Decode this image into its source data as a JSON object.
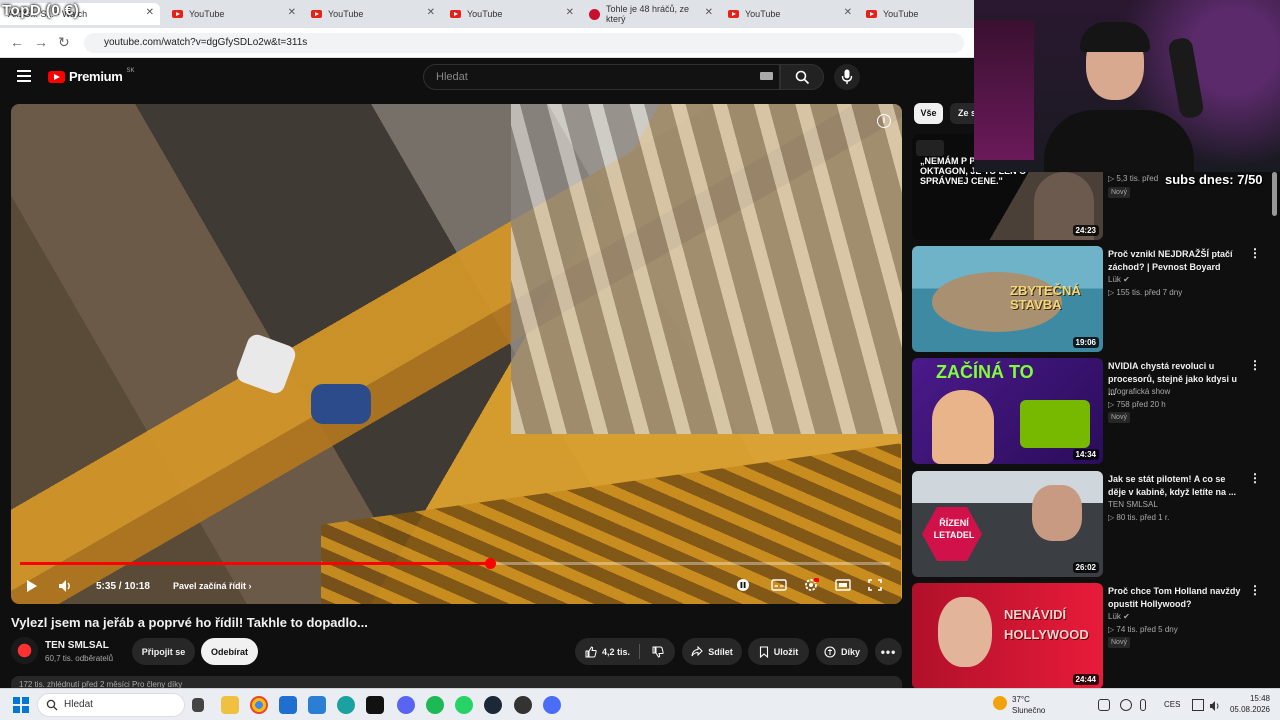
{
  "overlay_title": "TopD (0 €)",
  "browser": {
    "tabs": [
      {
        "title": "Ak1G... S... - Watch"
      },
      {
        "title": "YouTube"
      },
      {
        "title": "YouTube"
      },
      {
        "title": "YouTube"
      },
      {
        "title": "Tohle je 48 hráčů, ze který"
      },
      {
        "title": "YouTube"
      },
      {
        "title": "YouTube"
      }
    ],
    "url": "youtube.com/watch?v=dgGfySDLo2w&t=311s"
  },
  "header": {
    "logo_text": "Premium",
    "logo_country": "SK",
    "search_placeholder": "Hledat"
  },
  "player": {
    "time": "5:35 / 10:18",
    "chapter": "Pavel začíná řídit",
    "progress": 0.54,
    "info_icon": "i"
  },
  "video": {
    "title": "Vylezl jsem na jeřáb a poprvé ho řídil! Takhle to dopadlo...",
    "channel_name": "TEN SMLSAL",
    "subscribers": "60,7 tis. odběratelů",
    "join_label": "Připojit se",
    "subscribe_label": "Odebírat",
    "likes": "4,2 tis.",
    "share_label": "Sdílet",
    "save_label": "Uložit",
    "thanks_label": "Díky",
    "desc_peek": "172 tis. zhlédnutí  před 2 měsíci    Pro členy díky"
  },
  "sidebar": {
    "chip_all": "Vše",
    "chip_from": "Ze s",
    "items": [
      {
        "title": "",
        "channel": "",
        "meta": "▷ 5,3 tis.   před",
        "badge": "Nový",
        "duration": "24:23",
        "thumb_text": "„NEMÁM P PREDAŤ OKTAGON, JE TO LEN O SPRÁVNEJ CENE.\""
      },
      {
        "title": "Proč vznikl NEJDRAŽŠÍ ptačí záchod? | Pevnost Boyard",
        "channel": "Lük ✔",
        "meta": "▷ 155 tis.   před 7 dny",
        "badge": "",
        "duration": "19:06",
        "thumb_text": "ZBYTEČNÁ STAVBA"
      },
      {
        "title": "NVIDIA chystá revoluci u procesorů, stejně jako kdysi u ...",
        "channel": "Infografická show",
        "meta": "▷ 758   před 20 h",
        "badge": "Nový",
        "duration": "14:34",
        "thumb_text": "ZAČÍNÁ TO"
      },
      {
        "title": "Jak se stát pilotem! A co se děje v kabině, když letíte na ...",
        "channel": "TEN SMLSAL",
        "meta": "▷ 80 tis.   před 1 r.",
        "badge": "",
        "duration": "26:02",
        "thumb_text": "ŘÍZENÍ LETADEL"
      },
      {
        "title": "Proč chce Tom Holland navždy opustit Hollywood?",
        "channel": "Lük ✔",
        "meta": "▷ 74 tis.   před 5 dny",
        "badge": "Nový",
        "duration": "24:44",
        "thumb_text": "NENÁVIDÍ HOLLYWOOD"
      }
    ]
  },
  "stream_overlay": {
    "subs_text": "subs dnes: 7/50"
  },
  "taskbar": {
    "search_placeholder": "Hledat",
    "weather_temp": "37°C",
    "weather_cond": "Slunečno",
    "language": "CES",
    "time": "15:48",
    "date": "05.08.2026"
  },
  "colors": {
    "yt_red": "#ff0000",
    "bg": "#0f0f0f",
    "chip_active": "#f1f1f1"
  }
}
